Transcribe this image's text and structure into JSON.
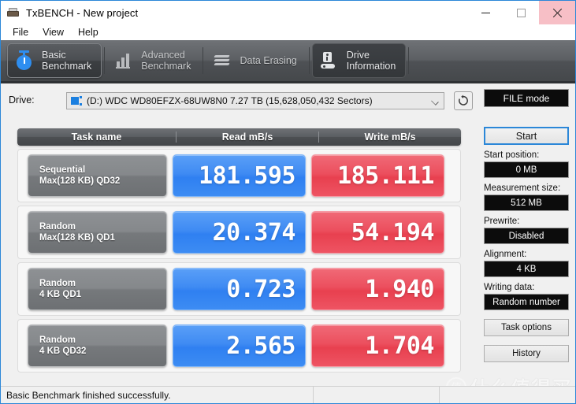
{
  "window": {
    "title": "TxBENCH - New project",
    "app_icon": "drive-icon",
    "minimize_label": "—",
    "maximize_label": "□",
    "close_label": "✕",
    "close_highlight_color": "#f7bfc6"
  },
  "menu": {
    "items": [
      {
        "label": "File"
      },
      {
        "label": "View"
      },
      {
        "label": "Help"
      }
    ]
  },
  "tabs": [
    {
      "label": "Basic\nBenchmark",
      "icon": "stopwatch-icon",
      "state": "active"
    },
    {
      "label": "Advanced\nBenchmark",
      "icon": "bar-chart-icon",
      "state": "normal"
    },
    {
      "label": "Data Erasing",
      "icon": "erase-icon",
      "state": "normal"
    },
    {
      "label": "Drive\nInformation",
      "icon": "drive-info-icon",
      "state": "hover"
    }
  ],
  "drive": {
    "label": "Drive:",
    "selected": "(D:) WDC WD80EFZX-68UW8N0  7.27 TB (15,628,050,432 Sectors)",
    "icon": "drive-select-icon",
    "dropdown_icon": "chevron-down-icon",
    "rescan_icon": "refresh-icon"
  },
  "results": {
    "columns": [
      "Task name",
      "Read mB/s",
      "Write mB/s"
    ],
    "rows": [
      {
        "name_line1": "Sequential",
        "name_line2": "Max(128 KB) QD32",
        "read": "181.595",
        "write": "185.111"
      },
      {
        "name_line1": "Random",
        "name_line2": "Max(128 KB) QD1",
        "read": "20.374",
        "write": "54.194"
      },
      {
        "name_line1": "Random",
        "name_line2": "4 KB QD1",
        "read": "0.723",
        "write": "1.940"
      },
      {
        "name_line1": "Random",
        "name_line2": "4 KB QD32",
        "read": "2.565",
        "write": "1.704"
      }
    ],
    "read_color": "#3d8cf3",
    "write_color": "#ec4f5e"
  },
  "panel": {
    "mode_label": "FILE mode",
    "start_label": "Start",
    "start_position_label": "Start position:",
    "start_position_value": "0 MB",
    "measurement_size_label": "Measurement size:",
    "measurement_size_value": "512 MB",
    "prewrite_label": "Prewrite:",
    "prewrite_value": "Disabled",
    "alignment_label": "Alignment:",
    "alignment_value": "4 KB",
    "writing_data_label": "Writing data:",
    "writing_data_value": "Random number",
    "task_options_label": "Task options",
    "history_label": "History",
    "accent_color": "#2b87d8"
  },
  "status": {
    "message": "Basic Benchmark finished successfully."
  },
  "watermark": {
    "text": "什么值得买",
    "logo_glyph": "值"
  }
}
